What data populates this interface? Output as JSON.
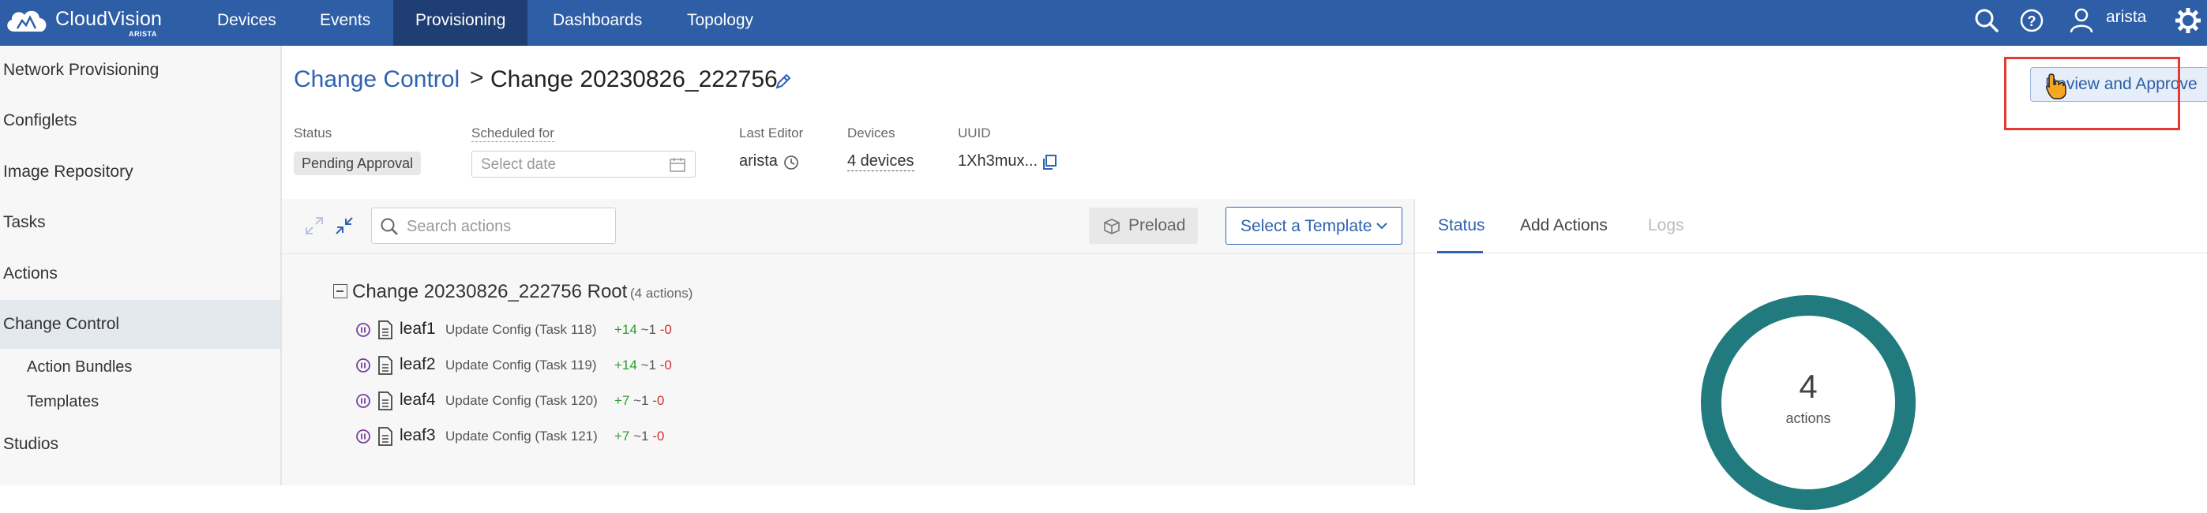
{
  "app": {
    "brand": "CloudVision",
    "brand_sub": "ARISTA",
    "user": "arista"
  },
  "nav": {
    "items": [
      {
        "label": "Devices"
      },
      {
        "label": "Events"
      },
      {
        "label": "Provisioning",
        "active": true
      },
      {
        "label": "Dashboards"
      },
      {
        "label": "Topology"
      }
    ]
  },
  "sidebar": {
    "items": [
      {
        "label": "Network Provisioning"
      },
      {
        "label": "Configlets"
      },
      {
        "label": "Image Repository"
      },
      {
        "label": "Tasks"
      },
      {
        "label": "Actions"
      },
      {
        "label": "Change Control",
        "active": true
      },
      {
        "label": "Action Bundles"
      },
      {
        "label": "Templates"
      },
      {
        "label": "Studios"
      }
    ]
  },
  "header": {
    "breadcrumb_link": "Change Control",
    "separator": ">",
    "title": "Change 20230826_222756",
    "review_button": "Review and Approve"
  },
  "meta": {
    "status_label": "Status",
    "status_value": "Pending Approval",
    "scheduled_label": "Scheduled for",
    "date_placeholder": "Select date",
    "last_editor_label": "Last Editor",
    "last_editor_value": "arista",
    "devices_label": "Devices",
    "devices_value": "4 devices",
    "uuid_label": "UUID",
    "uuid_value": "1Xh3mux..."
  },
  "toolbar": {
    "search_placeholder": "Search actions",
    "preload_label": "Preload",
    "template_label": "Select a Template"
  },
  "tree": {
    "root_title": "Change 20230826_222756 Root",
    "root_count": "(4 actions)",
    "actions": [
      {
        "device": "leaf1",
        "task": "Update Config (Task 118)",
        "add": "+14",
        "mod": "~1",
        "del": "-0"
      },
      {
        "device": "leaf2",
        "task": "Update Config (Task 119)",
        "add": "+14",
        "mod": "~1",
        "del": "-0"
      },
      {
        "device": "leaf4",
        "task": "Update Config (Task 120)",
        "add": "+7",
        "mod": "~1",
        "del": "-0"
      },
      {
        "device": "leaf3",
        "task": "Update Config (Task 121)",
        "add": "+7",
        "mod": "~1",
        "del": "-0"
      }
    ]
  },
  "right_panel": {
    "tabs": [
      {
        "label": "Status",
        "state": "active"
      },
      {
        "label": "Add Actions",
        "state": "normal"
      },
      {
        "label": "Logs",
        "state": "disabled"
      }
    ],
    "donut_count": "4",
    "donut_label": "actions",
    "donut_color": "#217a7e"
  },
  "colors": {
    "topbar": "#2e5ea6",
    "nav_active": "#1f3e73",
    "link": "#2e63b0",
    "highlight": "#e53935"
  }
}
